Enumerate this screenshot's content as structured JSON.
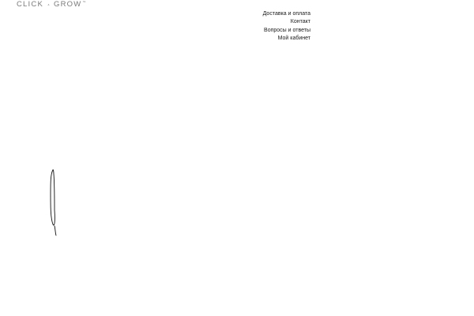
{
  "header": {
    "logo": {
      "left_word": "CLICK",
      "mark_top": "&",
      "right_word": "GROW",
      "trademark": "™",
      "color": "#7a7a7a"
    },
    "nav": {
      "items": [
        {
          "label": "Доставка и оплата"
        },
        {
          "label": "Контакт"
        },
        {
          "label": "Вопросы и ответы"
        },
        {
          "label": "Мой кабинет"
        }
      ]
    }
  },
  "main": {
    "decoration": "thin-loop-line"
  },
  "colors": {
    "background": "#ffffff",
    "text": "#1b1b1b",
    "line": "#111111"
  }
}
